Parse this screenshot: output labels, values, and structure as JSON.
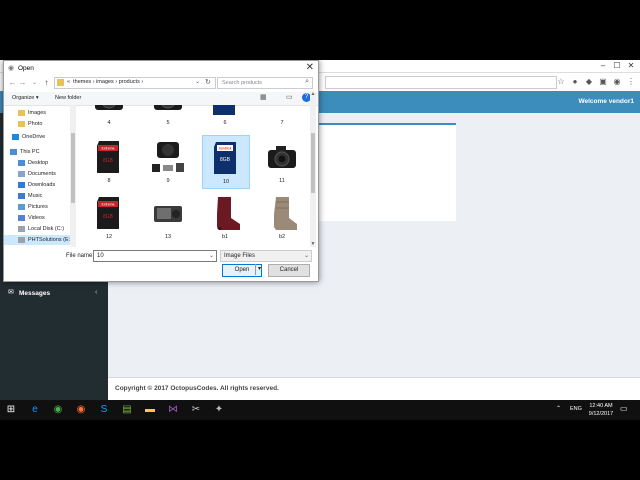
{
  "browser": {
    "address_text": "",
    "window_controls": [
      "–",
      "☐",
      "✕"
    ]
  },
  "app": {
    "welcome": "Welcome vendor1",
    "footer": "Copyright © 2017 OctopusCodes. All rights reserved.",
    "menu_messages": "Messages",
    "accent": "#3c8dbc",
    "sidebar_bg": "#222d32"
  },
  "dialog": {
    "title": "Open",
    "path_parts": [
      "«",
      "themes",
      "›",
      "images",
      "›",
      "products",
      "›"
    ],
    "search_placeholder": "Search products",
    "organize": "Organize ▾",
    "new_folder": "New folder",
    "nav_items": [
      {
        "label": "Images",
        "icon": "folder-icon"
      },
      {
        "label": "Photo",
        "icon": "folder-icon"
      },
      {
        "label": "OneDrive",
        "icon": "cloud-icon"
      },
      {
        "label": "This PC",
        "icon": "computer-icon"
      },
      {
        "label": "Desktop",
        "icon": "desktop-icon"
      },
      {
        "label": "Documents",
        "icon": "documents-icon"
      },
      {
        "label": "Downloads",
        "icon": "downloads-icon"
      },
      {
        "label": "Music",
        "icon": "music-icon"
      },
      {
        "label": "Pictures",
        "icon": "pictures-icon"
      },
      {
        "label": "Videos",
        "icon": "videos-icon"
      },
      {
        "label": "Local Disk (C:)",
        "icon": "drive-icon"
      },
      {
        "label": "PHTSolutions (E:",
        "icon": "drive-icon"
      }
    ],
    "files": [
      {
        "name": "4",
        "kind": "camera-dslr"
      },
      {
        "name": "5",
        "kind": "camera-dslr"
      },
      {
        "name": "6",
        "kind": "sd-card-blue"
      },
      {
        "name": "7",
        "kind": "card-reader"
      },
      {
        "name": "8",
        "kind": "sd-card-red"
      },
      {
        "name": "9",
        "kind": "camera-kit"
      },
      {
        "name": "10",
        "kind": "sd-card-blue"
      },
      {
        "name": "11",
        "kind": "camera-dslr"
      },
      {
        "name": "12",
        "kind": "sd-card-red"
      },
      {
        "name": "13",
        "kind": "camera-compact"
      },
      {
        "name": "b1",
        "kind": "boot-red"
      },
      {
        "name": "b2",
        "kind": "boot-tan"
      }
    ],
    "selected_file": "10",
    "filename_label": "File name:",
    "filename_value": "10",
    "filter_value": "Image Files",
    "open_label": "Open",
    "cancel_label": "Cancel"
  },
  "taskbar": {
    "time": "12:40 AM",
    "date": "9/12/2017",
    "lang": "ENG"
  }
}
